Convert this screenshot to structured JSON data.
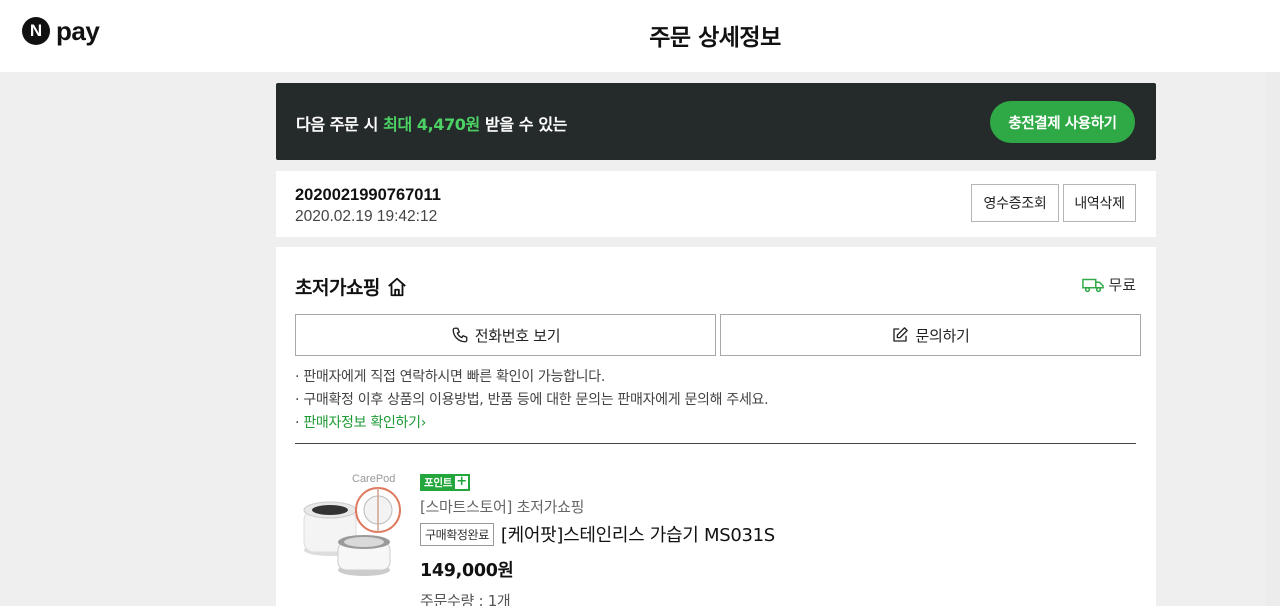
{
  "header": {
    "logo_letter": "N",
    "logo_text": "pay",
    "title": "주문 상세정보"
  },
  "banner": {
    "text_before": "다음 주문 시 ",
    "highlight": "최대 4,470원",
    "text_after": " 받을 수 있는",
    "button_label": "충전결제 사용하기"
  },
  "order": {
    "number": "2020021990767011",
    "datetime": "2020.02.19 19:42:12",
    "receipt_button": "영수증조회",
    "delete_button": "내역삭제"
  },
  "seller": {
    "name": "초저가쇼핑",
    "delivery_label": "무료",
    "phone_button": "전화번호 보기",
    "inquiry_button": "문의하기",
    "notices": [
      "판매자에게 직접 연락하시면 빠른 확인이 가능합니다.",
      "구매확정 이후 상품의 이용방법, 반품 등에 대한 문의는 판매자에게 문의해 주세요."
    ],
    "info_link": "판매자정보 확인하기"
  },
  "product": {
    "image_brand": "CarePod",
    "point_badge": "포인트",
    "point_plus": "+",
    "store": "[스마트스토어] 초저가쇼핑",
    "status": "구매확정완료",
    "name": "[케어팟]스테인리스 가습기 MS031S",
    "price": "149,000원",
    "quantity": "주문수량 : 1개"
  },
  "colors": {
    "accent_green": "#2fa946",
    "banner_bg": "#252b2b",
    "highlight_green": "#4bd164"
  }
}
